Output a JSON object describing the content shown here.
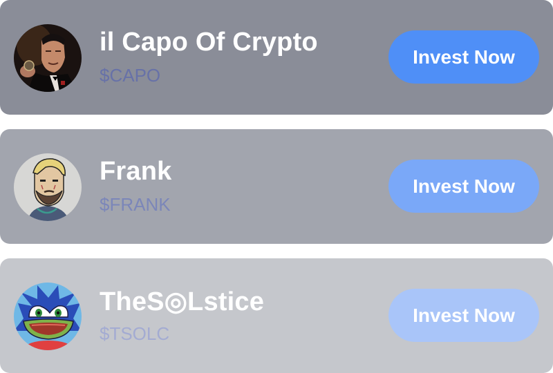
{
  "tokens": [
    {
      "name": "il Capo Of Crypto",
      "ticker": "$CAPO",
      "cta": "Invest Now",
      "avatar_icon": "godfather-portrait-avatar"
    },
    {
      "name": "Frank",
      "ticker": "$FRANK",
      "cta": "Invest Now",
      "avatar_icon": "bearded-man-cartoon-avatar"
    },
    {
      "name": "TheS◎Lstice",
      "ticker": "$TSOLC",
      "cta": "Invest Now",
      "avatar_icon": "blue-hedgehog-frog-avatar"
    }
  ],
  "colors": {
    "card_1": "#8a8d98",
    "card_2": "#a2a5ae",
    "card_3": "#c5c7cc",
    "button_1": "#4f8ff7",
    "button_2": "#7aa8f8",
    "button_3": "#a9c5f9"
  }
}
